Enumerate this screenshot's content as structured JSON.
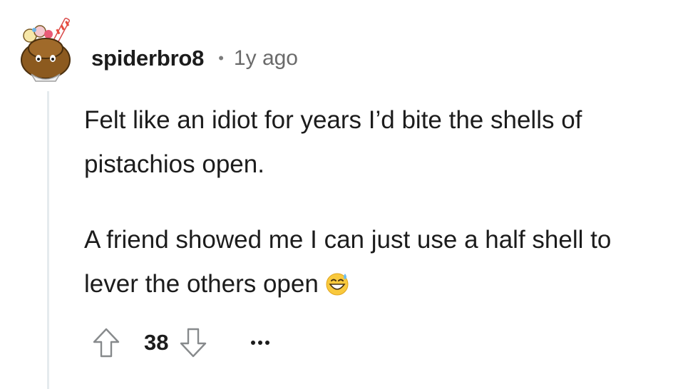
{
  "comment": {
    "username": "spiderbro8",
    "separator": "•",
    "timestamp": "1y ago",
    "paragraphs": [
      "Felt like an idiot for years I’d bite the shells of pistachios open.",
      "A friend showed me I can just use a half shell to lever the others open"
    ],
    "emoji": "grinning-face-with-sweat-icon",
    "score": "38",
    "icons": {
      "upvote": "upvote-arrow-icon",
      "downvote": "downvote-arrow-icon",
      "more": "more-options-icon",
      "avatar": "avatar"
    },
    "colors": {
      "text": "#1c1c1c",
      "muted": "#6a6a6a",
      "thread_line": "#e5ebee",
      "icon_stroke": "#878a8c"
    }
  }
}
